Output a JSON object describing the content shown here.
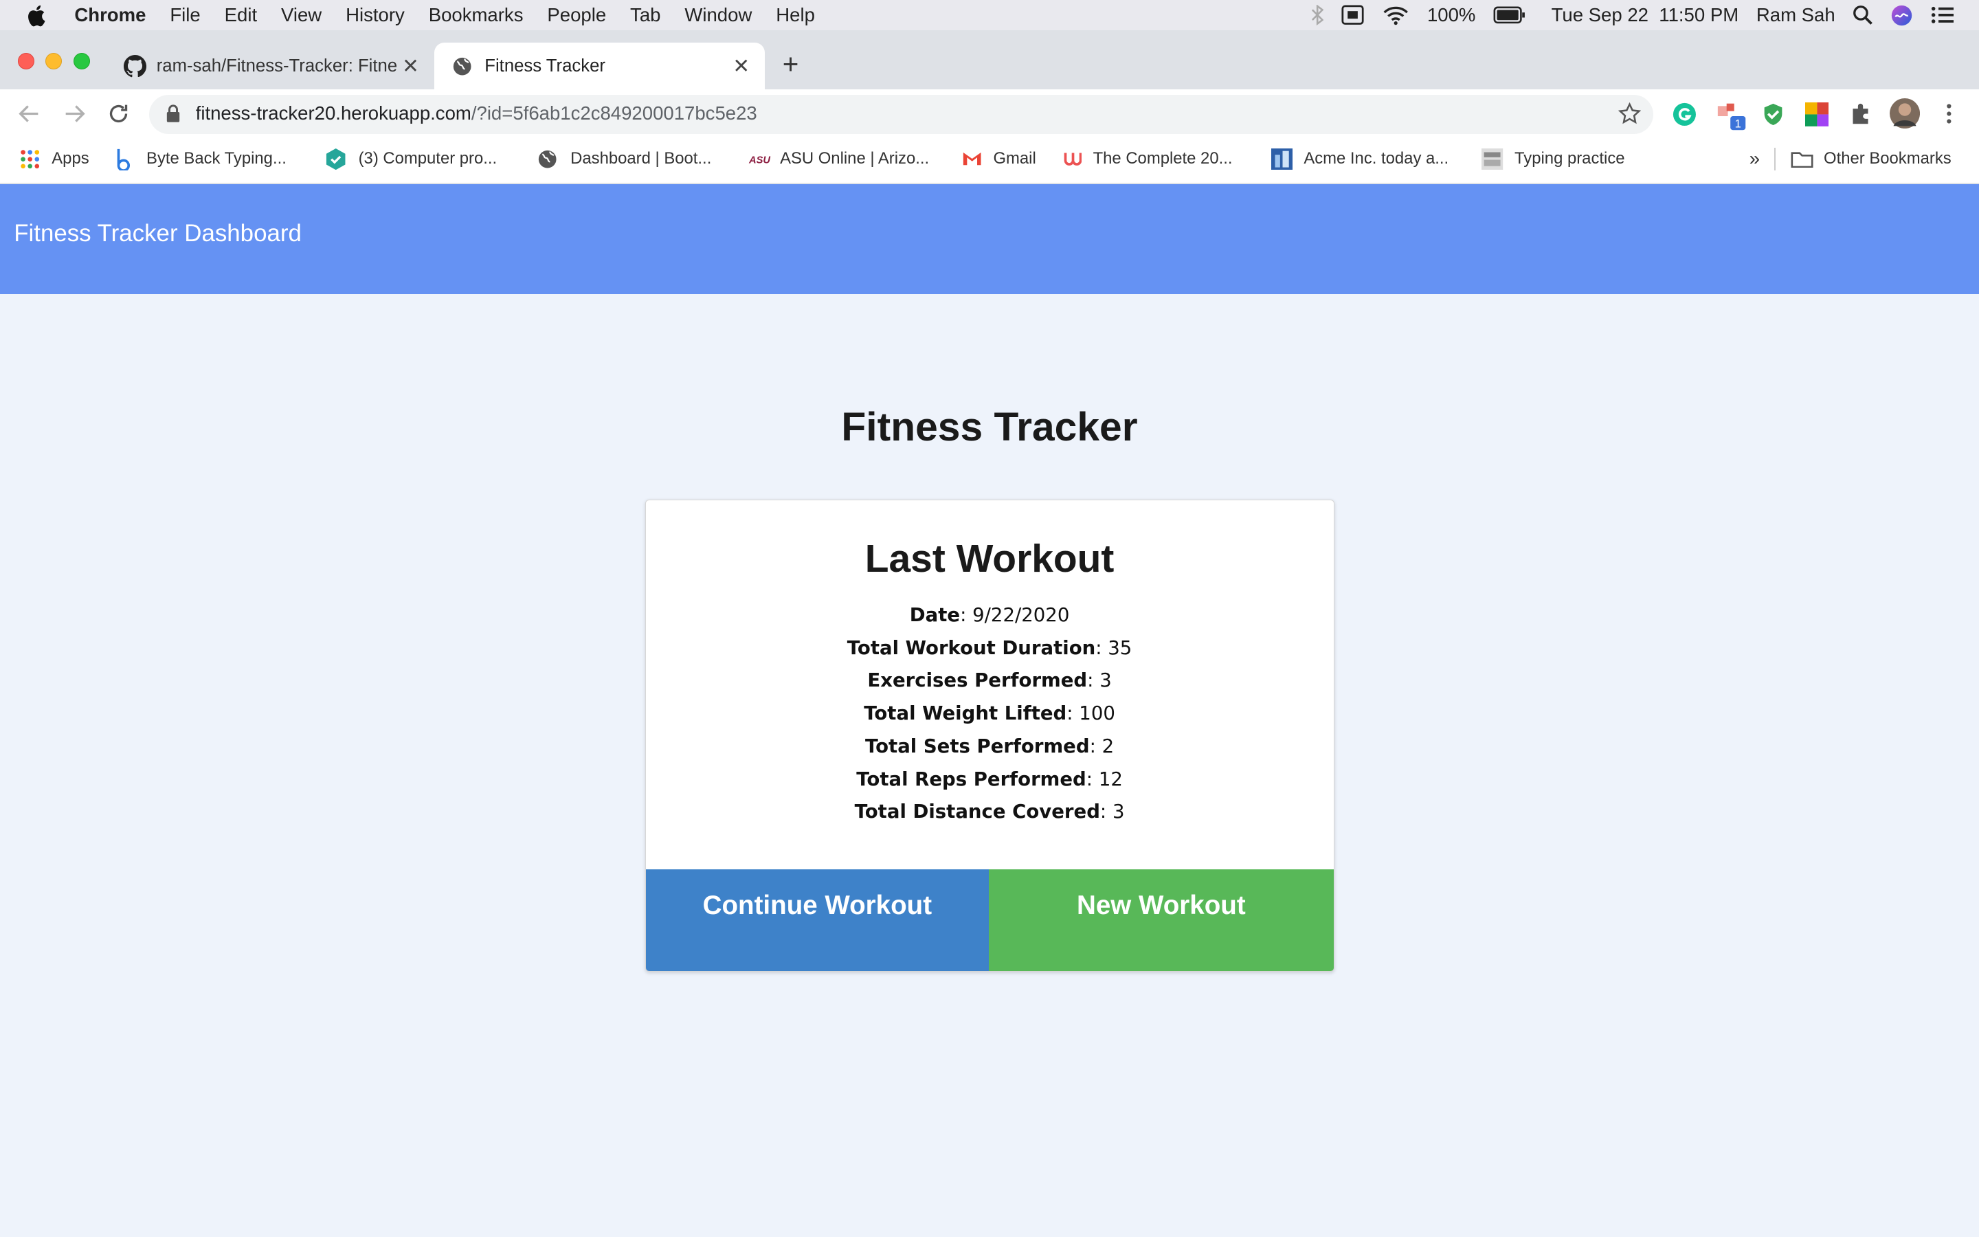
{
  "menubar": {
    "app": "Chrome",
    "items": [
      "File",
      "Edit",
      "View",
      "History",
      "Bookmarks",
      "People",
      "Tab",
      "Window",
      "Help"
    ],
    "battery": "100%",
    "datetime": "Tue Sep 22  11:50 PM",
    "user": "Ram Sah"
  },
  "tabs": [
    {
      "title": "ram-sah/Fitness-Tracker: Fitne",
      "icon": "github-icon"
    },
    {
      "title": "Fitness Tracker",
      "icon": "globe-icon"
    }
  ],
  "address": {
    "host": "fitness-tracker20.herokuapp.com",
    "path": "/?id=5f6ab1c2c849200017bc5e23"
  },
  "bookmarks": {
    "apps": "Apps",
    "items": [
      "Byte Back Typing...",
      "(3) Computer pro...",
      "Dashboard | Boot...",
      "ASU Online | Arizo...",
      "Gmail",
      "The Complete 20...",
      "Acme Inc. today a...",
      "Typing practice"
    ],
    "overflow": "»",
    "other": "Other Bookmarks"
  },
  "page": {
    "brand": "Fitness Tracker Dashboard",
    "title": "Fitness Tracker",
    "card_title": "Last Workout",
    "stats": [
      {
        "label": "Date",
        "value": ": 9/22/2020"
      },
      {
        "label": "Total Workout Duration",
        "value": ": 35"
      },
      {
        "label": "Exercises Performed",
        "value": ": 3"
      },
      {
        "label": "Total Weight Lifted",
        "value": ": 100"
      },
      {
        "label": "Total Sets Performed",
        "value": ": 2"
      },
      {
        "label": "Total Reps Performed",
        "value": ": 12"
      },
      {
        "label": "Total Distance Covered",
        "value": ": 3"
      }
    ],
    "continue_label": "Continue Workout",
    "new_label": "New Workout"
  },
  "colors": {
    "navbar": "#6592f3",
    "continue": "#3e82c9",
    "new": "#58b858",
    "background": "#eef3fb"
  }
}
